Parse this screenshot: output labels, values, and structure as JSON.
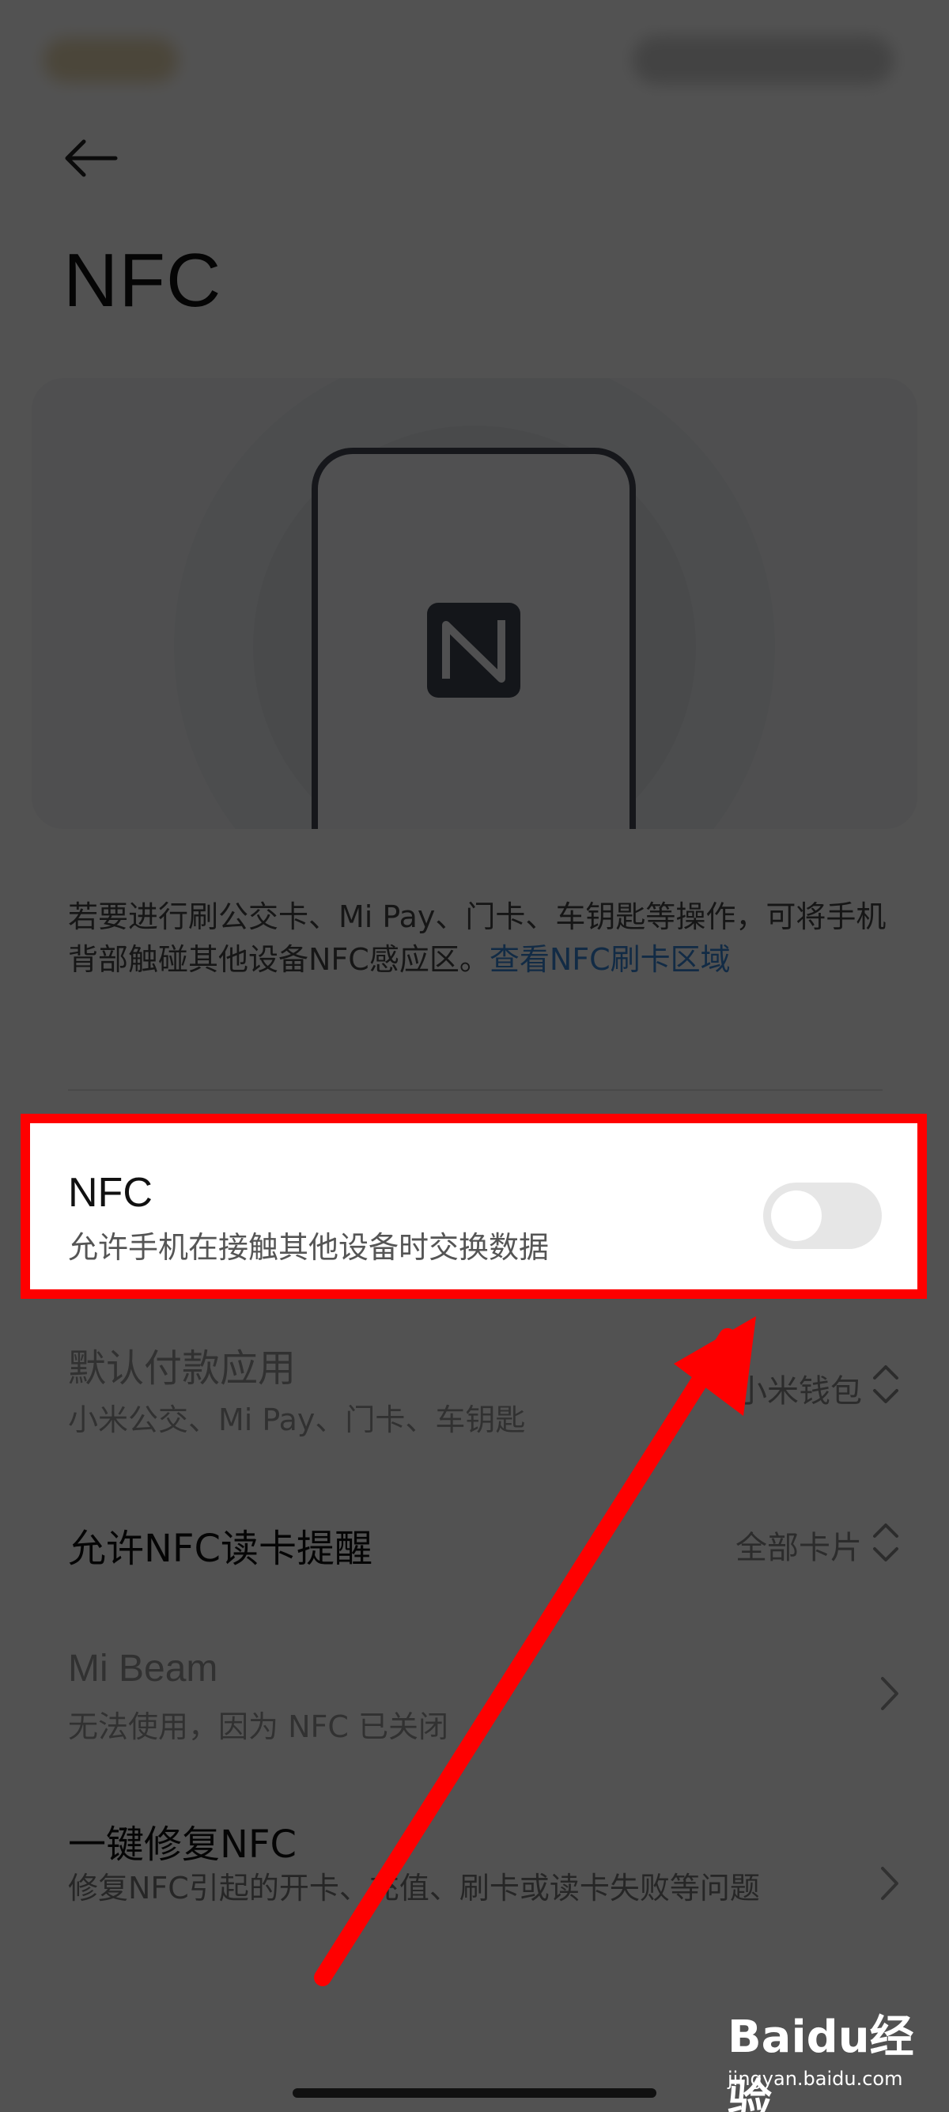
{
  "header": {
    "title": "NFC"
  },
  "description": {
    "text": "若要进行刷公交卡、Mi Pay、门卡、车钥匙等操作，可将手机背部触碰其他设备NFC感应区。",
    "link": "查看NFC刷卡区域"
  },
  "nfc_setting": {
    "label": "NFC",
    "summary": "允许手机在接触其他设备时交换数据",
    "enabled": false
  },
  "default_payment": {
    "label": "默认付款应用",
    "summary": "小米公交、Mi Pay、门卡、车钥匙",
    "value": "小米钱包"
  },
  "nfc_read_reminder": {
    "label": "允许NFC读卡提醒",
    "value": "全部卡片"
  },
  "mi_beam": {
    "label": "Mi Beam",
    "summary": "无法使用，因为 NFC 已关闭"
  },
  "repair_nfc": {
    "label": "一键修复NFC",
    "summary": "修复NFC引起的开卡、充值、刷卡或读卡失败等问题"
  },
  "watermark": {
    "brand": "Baidu经验",
    "site": "jingyan.baidu.com"
  },
  "colors": {
    "link": "#3a86d6",
    "highlight": "#ff0000",
    "toggle_off": "#e6e6e6"
  }
}
